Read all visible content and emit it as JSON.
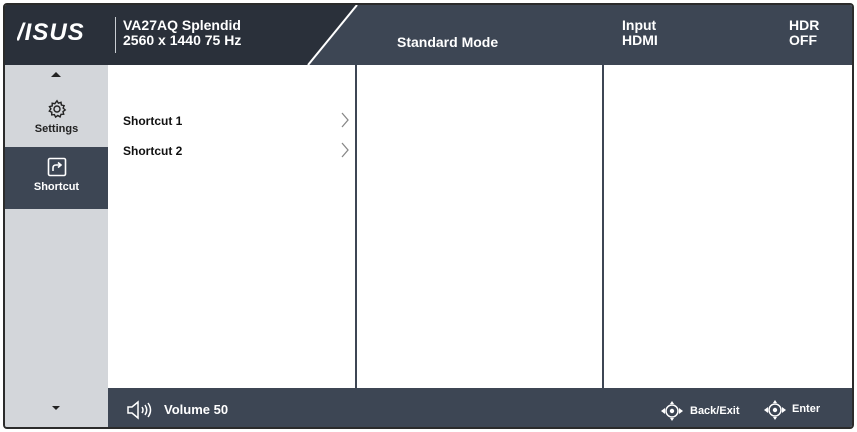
{
  "header": {
    "logo_text": "/ISUS",
    "model_name": "VA27AQ Splendid",
    "resolution": "2560 x 1440 75 Hz",
    "mode": "Standard Mode",
    "input_label": "Input",
    "input_value": "HDMI",
    "hdr_label": "HDR",
    "hdr_value": "OFF"
  },
  "sidebar": {
    "items": [
      {
        "label": "Settings",
        "icon": "gear-icon"
      },
      {
        "label": "Shortcut",
        "icon": "shortcut-icon",
        "selected": true
      }
    ]
  },
  "menu": {
    "items": [
      {
        "label": "Shortcut 1"
      },
      {
        "label": "Shortcut 2"
      }
    ]
  },
  "footer": {
    "volume_label": "Volume 50",
    "back_label": "Back/Exit",
    "enter_label": "Enter"
  },
  "colors": {
    "bar_dark": "#3d4654",
    "sidebar_gray": "#d3d6da",
    "text_white": "#ffffff"
  }
}
